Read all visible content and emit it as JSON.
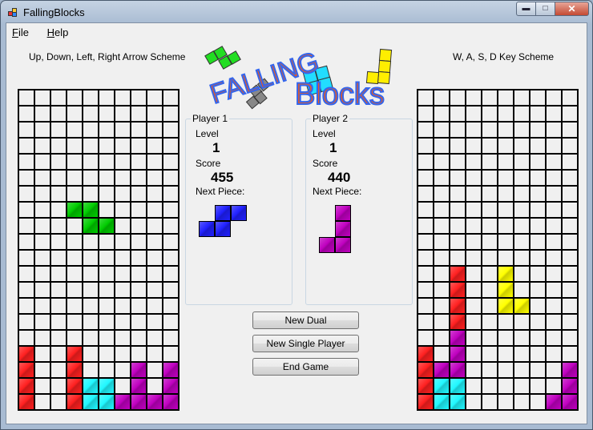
{
  "window": {
    "title": "FallingBlocks",
    "controls": {
      "minimize": "minimize-icon",
      "maximize": "maximize-icon",
      "close": "close-icon"
    }
  },
  "menu": [
    {
      "label": "File",
      "mnemonic": "F",
      "rest": "ile"
    },
    {
      "label": "Help",
      "mnemonic": "H",
      "rest": "elp"
    }
  ],
  "schemes": {
    "left": "Up, Down, Left, Right Arrow Scheme",
    "right": "W, A, S, D Key Scheme"
  },
  "logo": {
    "line1": "FALLING",
    "line2": "Blocks"
  },
  "colors": {
    "G": "#00cc00",
    "R": "#ff2020",
    "C": "#20f8ff",
    "P": "#c000c0",
    "Y": "#ffff00",
    "B": "#2020ff",
    "empty": "#f0f0f0"
  },
  "player1": {
    "title": "Player 1",
    "level_label": "Level",
    "level": "1",
    "score_label": "Score",
    "score": "455",
    "next_label": "Next Piece:",
    "next_piece": [
      ".BB",
      "BB."
    ]
  },
  "player2": {
    "title": "Player 2",
    "level_label": "Level",
    "level": "1",
    "score_label": "Score",
    "score": "440",
    "next_label": "Next Piece:",
    "next_piece": [
      ".P",
      ".P",
      "PP"
    ]
  },
  "buttons": {
    "new_dual": "New Dual",
    "new_single": "New Single Player",
    "end_game": "End Game"
  },
  "board_left": [
    "..........",
    "..........",
    "..........",
    "..........",
    "..........",
    "..........",
    "..........",
    "...GG.....",
    "....GG....",
    "..........",
    "..........",
    "..........",
    "..........",
    "..........",
    "..........",
    "..........",
    "R..R......",
    "R..R...P.P",
    "R..RCC.P.P",
    "R..RCCPPPP"
  ],
  "board_right": [
    "..........",
    "..........",
    "..........",
    "..........",
    "..........",
    "..........",
    "..........",
    "..........",
    "..........",
    "..........",
    "..........",
    "..R..Y....",
    "..R..Y....",
    "..R..YY...",
    "..R.......",
    "..P.......",
    "R.P.......",
    "RPP......P",
    "RCC......P",
    "RCC.....PP"
  ]
}
